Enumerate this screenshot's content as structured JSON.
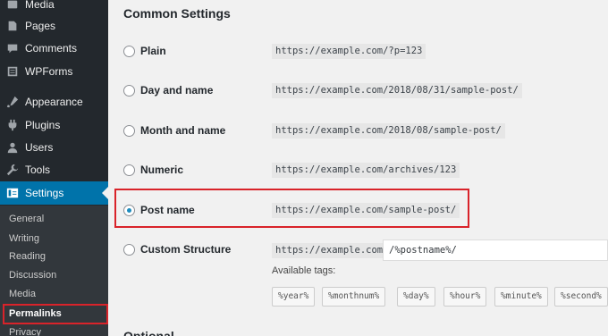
{
  "sidebar": {
    "items": [
      {
        "label": "Media",
        "icon": "media-icon"
      },
      {
        "label": "Pages",
        "icon": "pages-icon"
      },
      {
        "label": "Comments",
        "icon": "comments-icon"
      },
      {
        "label": "WPForms",
        "icon": "wpforms-icon"
      },
      {
        "label": "Appearance",
        "icon": "appearance-icon"
      },
      {
        "label": "Plugins",
        "icon": "plugins-icon"
      },
      {
        "label": "Users",
        "icon": "users-icon"
      },
      {
        "label": "Tools",
        "icon": "tools-icon"
      },
      {
        "label": "Settings",
        "icon": "settings-icon"
      }
    ],
    "submenu": [
      "General",
      "Writing",
      "Reading",
      "Discussion",
      "Media",
      "Permalinks",
      "Privacy"
    ]
  },
  "main": {
    "section_title": "Common Settings",
    "options": [
      {
        "label": "Plain",
        "example": "https://example.com/?p=123"
      },
      {
        "label": "Day and name",
        "example": "https://example.com/2018/08/31/sample-post/"
      },
      {
        "label": "Month and name",
        "example": "https://example.com/2018/08/sample-post/"
      },
      {
        "label": "Numeric",
        "example": "https://example.com/archives/123"
      },
      {
        "label": "Post name",
        "example": "https://example.com/sample-post/"
      },
      {
        "label": "Custom Structure",
        "example": "https://example.com"
      }
    ],
    "selected_option": "Post name",
    "custom_structure_value": "/%postname%/",
    "available_tags_label": "Available tags:",
    "tags": [
      "%year%",
      "%monthnum%",
      "%day%",
      "%hour%",
      "%minute%",
      "%second%"
    ],
    "next_section_title": "Optional"
  },
  "colors": {
    "sidebar_bg": "#23282d",
    "active_blue": "#0073aa",
    "highlight_red": "#d9232a"
  }
}
